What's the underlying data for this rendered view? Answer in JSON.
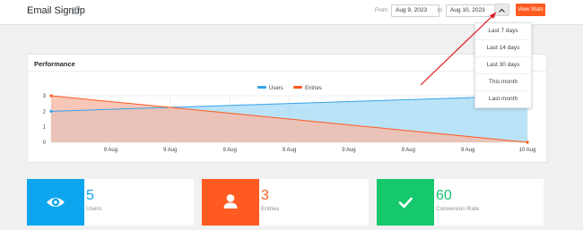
{
  "header": {
    "title": "Email Signup",
    "from_label": "From",
    "from_date": "Aug 9, 2023",
    "to_label": "to",
    "to_date": "Aug 10, 2023",
    "view_stats_label": "View Stats"
  },
  "dropdown": {
    "items": [
      "Last 7 days",
      "Last 14 days",
      "Last 30 days",
      "This month",
      "Last month"
    ]
  },
  "performance": {
    "title": "Performance"
  },
  "chart_data": {
    "type": "area",
    "title": "",
    "x": [
      "",
      "9 Aug",
      "9 Aug",
      "9 Aug",
      "9 Aug",
      "9 Aug",
      "9 Aug",
      "9 Aug",
      "10 Aug"
    ],
    "ylim": [
      0,
      3
    ],
    "yticks": [
      0,
      1,
      2,
      3
    ],
    "legend_position": "top-center",
    "series": [
      {
        "name": "Users",
        "color": "#36a2eb",
        "fill": "#a9dcf5",
        "start": [
          0,
          2
        ],
        "end": [
          8,
          3
        ]
      },
      {
        "name": "Entries",
        "color": "#ff5a1f",
        "fill": "#f6b9a6",
        "start": [
          0,
          3
        ],
        "end": [
          8,
          0
        ]
      }
    ]
  },
  "stats": [
    {
      "value": "5",
      "label": "Users",
      "color": "#0da6ee",
      "icon": "eye-icon"
    },
    {
      "value": "3",
      "label": "Entries",
      "color": "#ff5a1f",
      "icon": "user-icon"
    },
    {
      "value": "60",
      "label": "Conversion Rate",
      "color": "#15c86b",
      "icon": "check-icon"
    }
  ]
}
